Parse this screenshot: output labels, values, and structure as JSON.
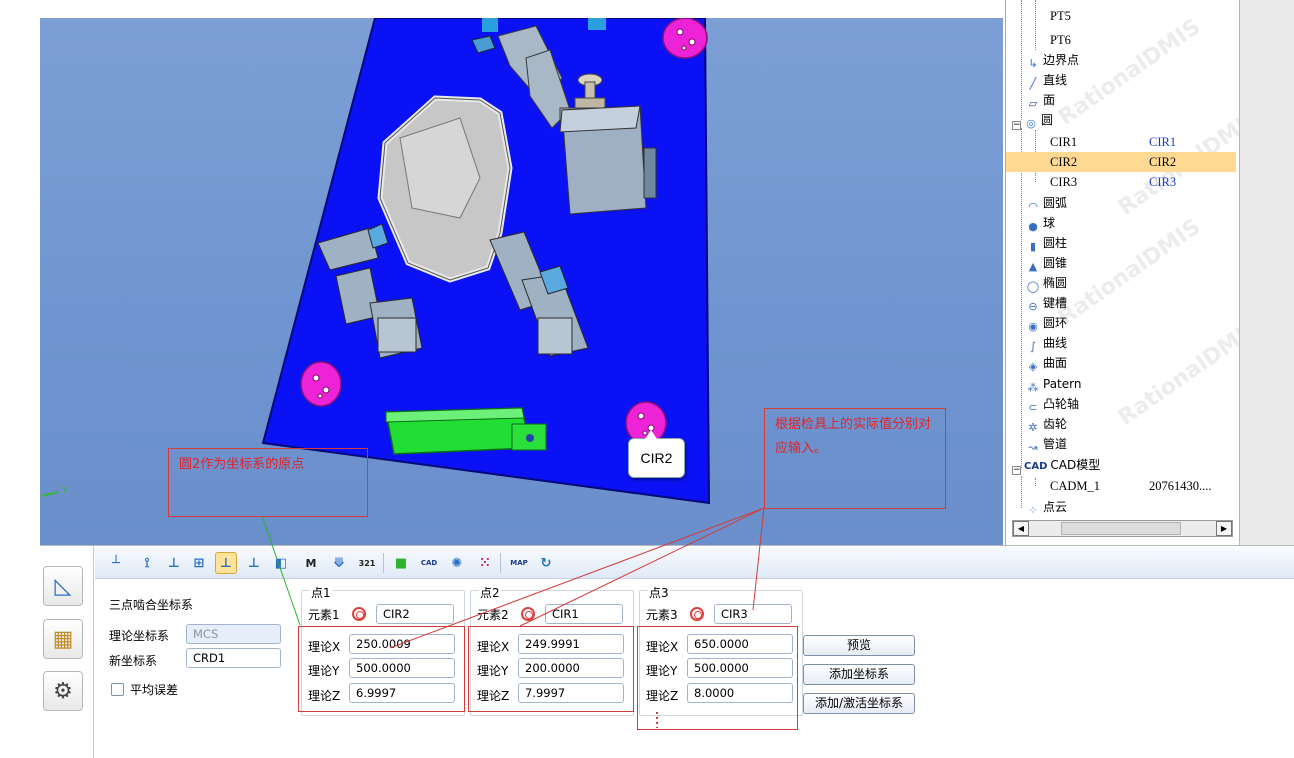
{
  "viewport": {
    "tooltip": "CIR2",
    "axis_y": "Y"
  },
  "annotations": {
    "origin_note": "圆2作为坐标系的原点",
    "input_note": "根据检具上的实际值分别对应输入。"
  },
  "tree": {
    "items": [
      {
        "label": "PT5",
        "value": ""
      },
      {
        "label": "PT6",
        "value": ""
      },
      {
        "label": "边界点",
        "value": ""
      },
      {
        "label": "直线",
        "value": ""
      },
      {
        "label": "面",
        "value": ""
      },
      {
        "label": "圆",
        "value": ""
      },
      {
        "label": "CIR1",
        "value": "CIR1"
      },
      {
        "label": "CIR2",
        "value": "CIR2"
      },
      {
        "label": "CIR3",
        "value": "CIR3"
      },
      {
        "label": "圆弧",
        "value": ""
      },
      {
        "label": "球",
        "value": ""
      },
      {
        "label": "圆柱",
        "value": ""
      },
      {
        "label": "圆锥",
        "value": ""
      },
      {
        "label": "椭圆",
        "value": ""
      },
      {
        "label": "键槽",
        "value": ""
      },
      {
        "label": "圆环",
        "value": ""
      },
      {
        "label": "曲线",
        "value": ""
      },
      {
        "label": "曲面",
        "value": ""
      },
      {
        "label": "Patern",
        "value": ""
      },
      {
        "label": "凸轮轴",
        "value": ""
      },
      {
        "label": "齿轮",
        "value": ""
      },
      {
        "label": "管道",
        "value": ""
      },
      {
        "label": "CAD模型",
        "value": ""
      },
      {
        "label": "CADM_1",
        "value": "20761430...."
      },
      {
        "label": "点云",
        "value": ""
      }
    ],
    "cad_prefix": "CAD",
    "watermark": "RationalDMIS"
  },
  "panel": {
    "title": "三点啮合坐标系",
    "theory_coord_label": "理论坐标系",
    "theory_coord_value": "MCS",
    "new_coord_label": "新坐标系",
    "new_coord_value": "CRD1",
    "average_error_label": "平均误差",
    "groups": [
      {
        "title": "点1",
        "element_label": "元素1",
        "element": "CIR2",
        "x_label": "理论X",
        "x": "250.0009",
        "y_label": "理论Y",
        "y": "500.0000",
        "z_label": "理论Z",
        "z": "6.9997"
      },
      {
        "title": "点2",
        "element_label": "元素2",
        "element": "CIR1",
        "x_label": "理论X",
        "x": "249.9991",
        "y_label": "理论Y",
        "y": "200.0000",
        "z_label": "理论Z",
        "z": "7.9997"
      },
      {
        "title": "点3",
        "element_label": "元素3",
        "element": "CIR3",
        "x_label": "理论X",
        "x": "650.0000",
        "y_label": "理论Y",
        "y": "500.0000",
        "z_label": "理论Z",
        "z": "8.0000"
      }
    ],
    "buttons": {
      "preview": "预览",
      "add_coord": "添加坐标系",
      "add_activate_coord": "添加/激活坐标系"
    }
  },
  "toolbar": {
    "icons": [
      "axis-align-icon",
      "two-line-icon",
      "line-plane-icon",
      "plane-icon",
      "three-point-icon",
      "three-axis-icon",
      "cube-icon",
      "matrix-icon",
      "translate-icon",
      "rps-321-icon",
      "green-cube-icon",
      "cad-icon",
      "gear-icon",
      "circle-points-icon",
      "map-icon",
      "rotate-icon"
    ],
    "sub_labels": {
      "matrix": "M",
      "rps": "321",
      "cad": "CAD",
      "map": "MAP"
    }
  }
}
